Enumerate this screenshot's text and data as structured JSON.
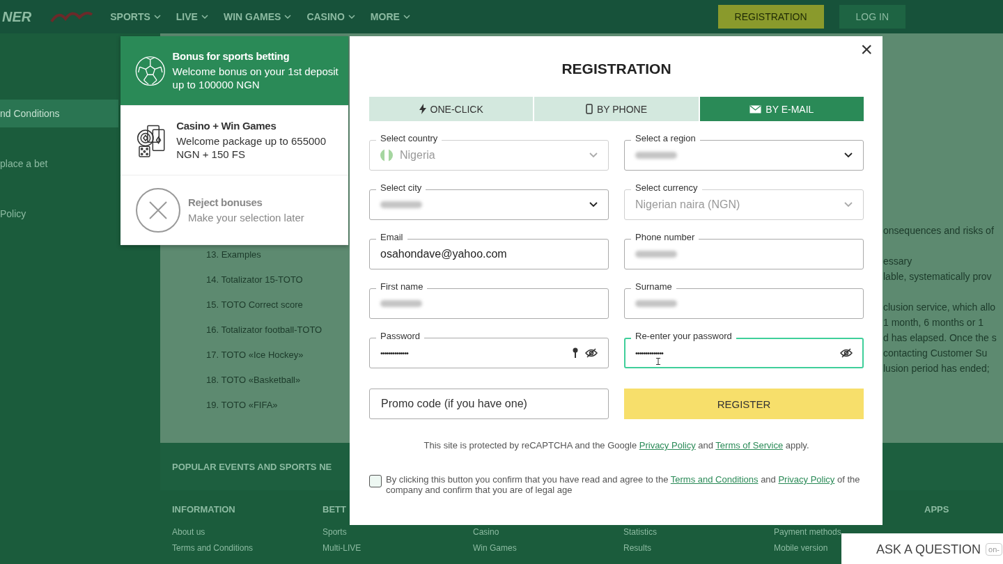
{
  "header": {
    "logo_text": "NER",
    "nav": [
      "SPORTS",
      "LIVE",
      "WIN GAMES",
      "CASINO",
      "MORE"
    ],
    "registration": "REGISTRATION",
    "login": "LOG IN"
  },
  "sidebar": {
    "items": [
      {
        "label": "nd Conditions",
        "selected": true
      },
      {
        "label": "place a bet",
        "selected": false
      },
      {
        "label": "Policy",
        "selected": false
      }
    ]
  },
  "content": {
    "list": [
      "13. Examples",
      "14. Totalizator 15-TOTO",
      "15. TOTO Correct score",
      "16. Totalizator football-TOTO",
      "17. TOTO «Ice Hockey»",
      "18. TOTO «Basketball»",
      "19. TOTO «FIFA»"
    ],
    "paragraphs": [
      [
        "onsequences and risks of"
      ],
      [
        "essary",
        "lable, systematically prov"
      ],
      [
        "clusion service, which allo",
        "1 month, 6 months or 1",
        "d has elapsed. Once the s",
        "contacting Customer Su",
        "lusion period has ended;"
      ]
    ]
  },
  "footer": {
    "popular": "POPULAR EVENTS AND SPORTS NE",
    "columns": [
      {
        "heading": "INFORMATION",
        "items": [
          "About us",
          "Terms and Conditions"
        ]
      },
      {
        "heading": "BETT",
        "items": [
          "Sports",
          "Multi-LIVE"
        ]
      },
      {
        "items": [
          "Casino",
          "Win Games"
        ]
      },
      {
        "items": [
          "Statistics",
          "Results"
        ]
      },
      {
        "items": [
          "Payment methods",
          "Mobile version"
        ]
      },
      {
        "heading": "APPS"
      }
    ]
  },
  "ask": {
    "label": "ASK A QUESTION",
    "field": "on-"
  },
  "bonuses": [
    {
      "kind": "sports",
      "title": "Bonus for sports betting",
      "text": "Welcome bonus on your 1st deposit up to 100000 NGN",
      "selected": true
    },
    {
      "kind": "casino",
      "title": "Casino + Win Games",
      "text": "Welcome package up to 655000 NGN + 150 FS",
      "selected": false
    },
    {
      "kind": "reject",
      "title": "Reject bonuses",
      "text": "Make your selection later",
      "selected": false
    }
  ],
  "modal": {
    "title": "REGISTRATION",
    "close": "×",
    "tabs": [
      {
        "kind": "bolt",
        "label": "ONE-CLICK",
        "selected": false
      },
      {
        "kind": "phone",
        "label": "BY PHONE",
        "selected": false
      },
      {
        "kind": "mail",
        "label": "BY E-MAIL",
        "selected": true
      }
    ],
    "fields": [
      {
        "kind": "select",
        "label": "Select country",
        "value": "Nigeria",
        "flag": true,
        "disabled": true,
        "masked": false
      },
      {
        "kind": "select",
        "label": "Select a region",
        "disabled": false,
        "masked": true
      },
      {
        "kind": "select",
        "label": "Select city",
        "disabled": false,
        "masked": true
      },
      {
        "kind": "select",
        "label": "Select currency",
        "value": "Nigerian naira (NGN)",
        "disabled": true,
        "masked": false
      },
      {
        "kind": "input",
        "label": "Email",
        "value": "osahondave@yahoo.com",
        "disabled": false,
        "masked": false
      },
      {
        "kind": "input",
        "label": "Phone number",
        "disabled": false,
        "masked": true
      },
      {
        "kind": "input",
        "label": "First name",
        "disabled": false,
        "masked": true
      },
      {
        "kind": "input",
        "label": "Surname",
        "disabled": false,
        "masked": true
      },
      {
        "kind": "password",
        "label": "Password",
        "value": "••••••••••••••",
        "key": true,
        "focused": false,
        "disabled": false,
        "masked": false
      },
      {
        "kind": "password",
        "label": "Re-enter your password",
        "value": "••••••••••••••",
        "focused": true,
        "disabled": false,
        "masked": false
      }
    ],
    "promo_placeholder": "Promo code (if you have one)",
    "register": "REGISTER",
    "recaptcha": [
      {
        "text": "This site is protected by reCAPTCHA and the Google "
      },
      {
        "link": "Privacy Policy"
      },
      {
        "text": " and "
      },
      {
        "link": "Terms of Service"
      },
      {
        "text": " apply."
      }
    ],
    "agree": {
      "checked": false,
      "parts": [
        {
          "text": "By clicking this button you confirm that you have read and agree to the "
        },
        {
          "link": "Terms and Conditions"
        },
        {
          "text": " and "
        },
        {
          "link": "Privacy Policy"
        },
        {
          "text": " of the company and confirm that you are of legal age"
        }
      ]
    }
  }
}
